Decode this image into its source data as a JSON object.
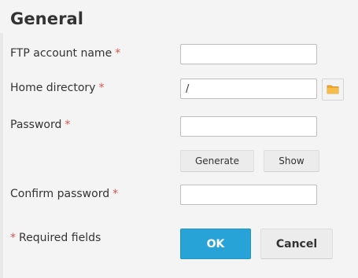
{
  "section": {
    "title": "General"
  },
  "fields": {
    "ftp_account_name": {
      "label": "FTP account name",
      "required_mark": "*",
      "value": ""
    },
    "home_directory": {
      "label": "Home directory",
      "required_mark": "*",
      "value": "/"
    },
    "password": {
      "label": "Password",
      "required_mark": "*",
      "value": ""
    },
    "confirm_password": {
      "label": "Confirm password",
      "required_mark": "*",
      "value": ""
    }
  },
  "password_actions": {
    "generate_label": "Generate",
    "show_label": "Show"
  },
  "footer": {
    "required_mark": "*",
    "required_note": "Required fields",
    "ok_label": "OK",
    "cancel_label": "Cancel"
  },
  "icons": {
    "folder": "folder-icon"
  },
  "colors": {
    "accent": "#28a3d8",
    "required": "#d9534f",
    "folder": "#f0a830"
  }
}
